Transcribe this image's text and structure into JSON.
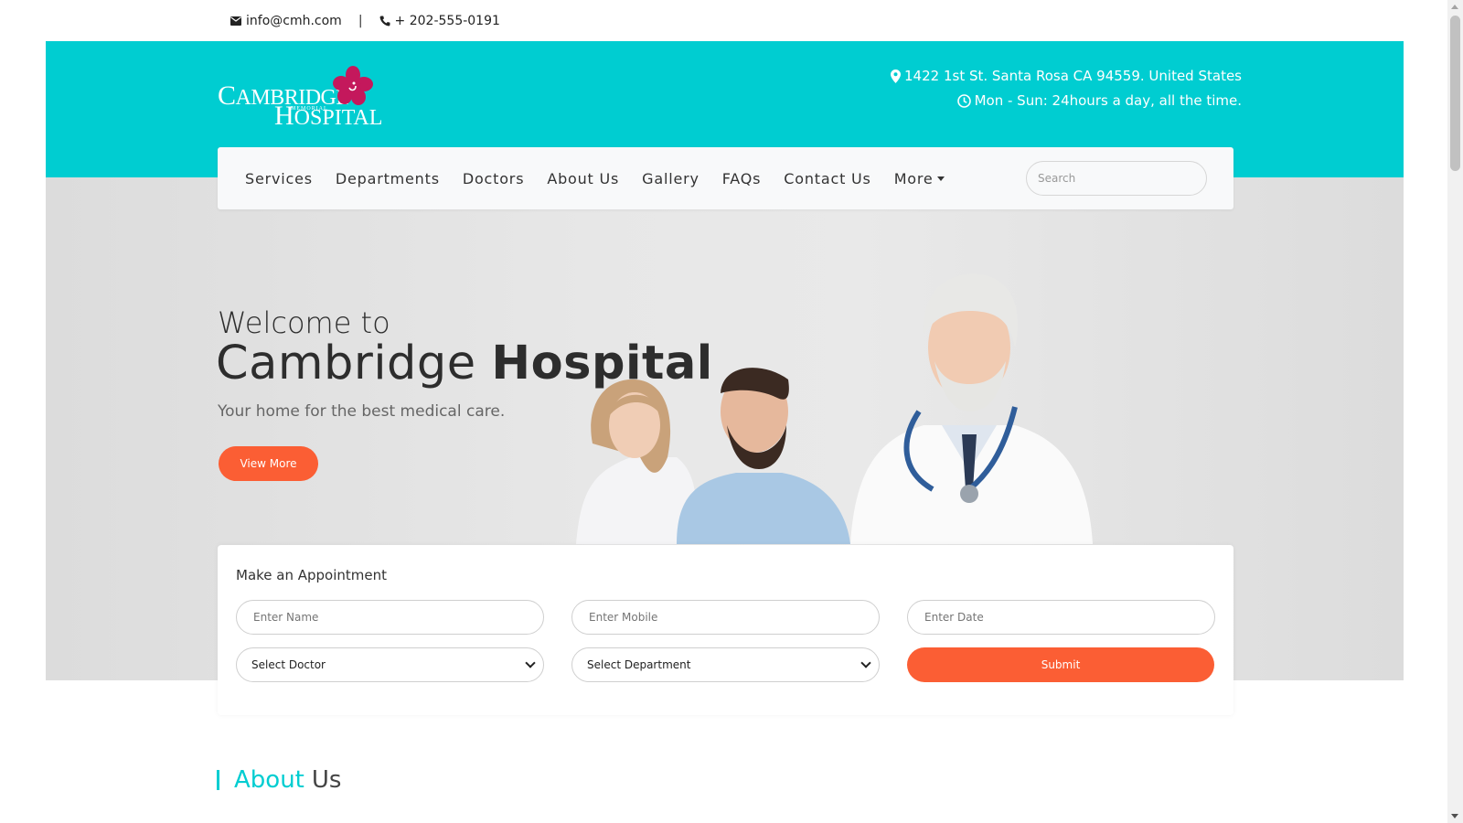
{
  "topbar": {
    "email": "info@cmh.com",
    "separator": "|",
    "phone": "+ 202-555-0191",
    "email_icon": "mail-icon",
    "phone_icon": "phone-icon"
  },
  "logo": {
    "line1": "CAMBRIDGE",
    "line2": "HOSPITAL",
    "small": "MEMORIAL"
  },
  "header_info": {
    "address": "1422 1st St. Santa Rosa CA 94559. United States",
    "hours": "Mon - Sun: 24hours a day, all the time.",
    "address_icon": "map-pin-icon",
    "hours_icon": "clock-icon"
  },
  "nav": {
    "items": [
      "Services",
      "Departments",
      "Doctors",
      "About Us",
      "Gallery",
      "FAQs",
      "Contact Us"
    ],
    "more_label": "More",
    "search_placeholder": "Search"
  },
  "hero": {
    "welcome": "Welcome to",
    "title_light": "Cambridge ",
    "title_bold": "Hospital",
    "tagline": "Your home for the best medical care.",
    "button": "View More"
  },
  "appointment": {
    "heading": "Make an Appointment",
    "name_placeholder": "Enter Name",
    "mobile_placeholder": "Enter Mobile",
    "date_placeholder": "Enter Date",
    "doctor_select": "Select Doctor",
    "department_select": "Select Department",
    "submit": "Submit"
  },
  "about": {
    "highlight": "About",
    "rest": "Us"
  },
  "colors": {
    "teal": "#00cdd1",
    "orange": "#fb5e34",
    "logo_flower": "#c4185c"
  }
}
